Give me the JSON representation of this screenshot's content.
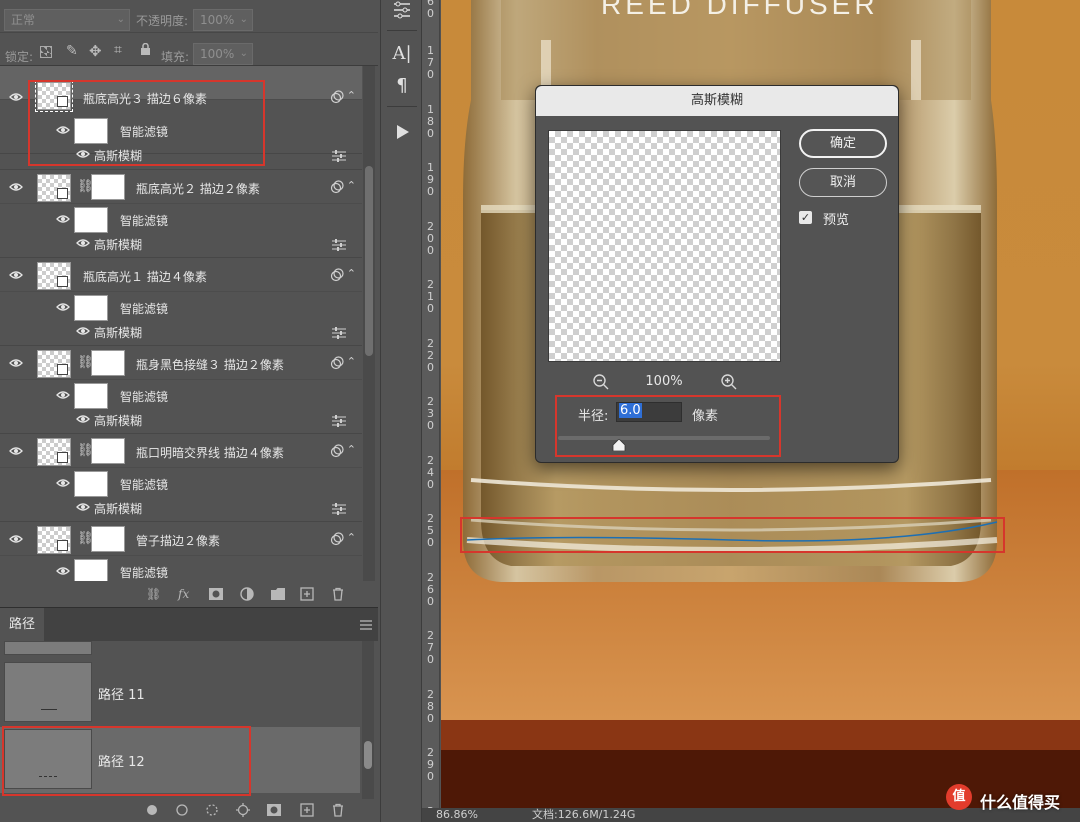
{
  "options_bar": {
    "blend_mode": "正常",
    "opacity_label": "不透明度:",
    "opacity_value": "100%",
    "lock_label": "锁定:",
    "fill_label": "填充:",
    "fill_value": "100%"
  },
  "layers": [
    {
      "name": "瓶底高光３ 描边６像素",
      "filter_label": "智能滤镜",
      "filter_item": "高斯模糊",
      "selected": true
    },
    {
      "name": "瓶底高光２ 描边２像素",
      "filter_label": "智能滤镜",
      "filter_item": "高斯模糊",
      "selected": false
    },
    {
      "name": "瓶底高光１ 描边４像素",
      "filter_label": "智能滤镜",
      "filter_item": "高斯模糊",
      "selected": false
    },
    {
      "name": "瓶身黑色接缝３ 描边２像素",
      "filter_label": "智能滤镜",
      "filter_item": "高斯模糊",
      "selected": false
    },
    {
      "name": "瓶口明暗交界线 描边４像素",
      "filter_label": "智能滤镜",
      "filter_item": "高斯模糊",
      "selected": false
    },
    {
      "name": "管子描边２像素",
      "filter_label": "智能滤镜",
      "filter_item": "",
      "selected": false
    }
  ],
  "paths_panel": {
    "tab_label": "路径",
    "paths": [
      {
        "name": "路径 11",
        "selected": false
      },
      {
        "name": "路径 12",
        "selected": true
      }
    ]
  },
  "ruler": {
    "digits": [
      "6",
      "0",
      "1",
      "7",
      "0",
      "1",
      "8",
      "0",
      "1",
      "9",
      "0",
      "2",
      "0",
      "0",
      "2",
      "1",
      "0",
      "2",
      "2",
      "0",
      "2",
      "3",
      "0",
      "2",
      "4",
      "0",
      "2",
      "5",
      "0",
      "2",
      "6",
      "0",
      "2",
      "7",
      "0",
      "2",
      "8",
      "0",
      "2",
      "9",
      "0",
      "3"
    ]
  },
  "canvas": {
    "label_text": "REED DIFFUSER"
  },
  "status_bar": {
    "zoom": "86.86%",
    "doc_info": "文档:126.6M/1.24G"
  },
  "dialog": {
    "title": "高斯模糊",
    "ok_label": "确定",
    "cancel_label": "取消",
    "preview_label": "预览",
    "preview_checked": true,
    "zoom_level": "100%",
    "radius_label": "半径:",
    "radius_value": "6.0",
    "radius_unit": "像素",
    "radius_slider_fraction": 0.29
  },
  "watermark": {
    "text": "什么值得买",
    "logo_char": "值"
  }
}
